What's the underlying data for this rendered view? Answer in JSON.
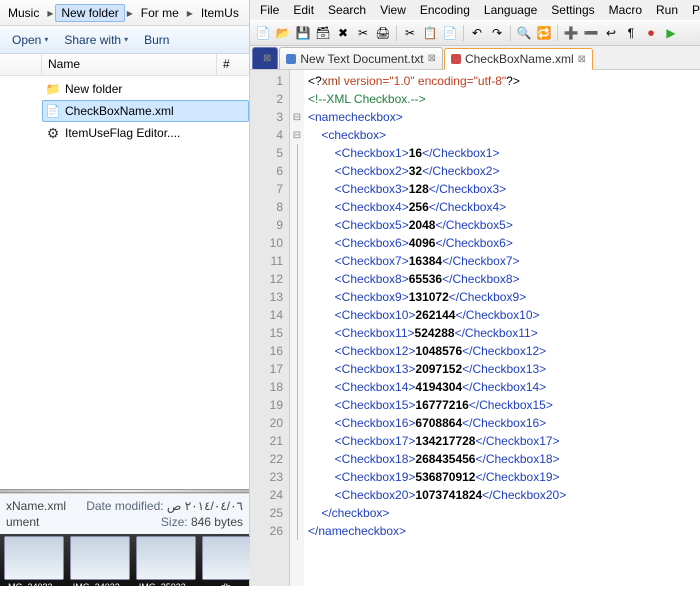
{
  "breadcrumb": {
    "items": [
      "Music",
      "New folder",
      "For me",
      "ItemUs"
    ]
  },
  "toolbar": {
    "open": "Open",
    "share": "Share with",
    "burn": "Burn"
  },
  "file_columns": {
    "name": "Name",
    "hash": "#"
  },
  "files": [
    {
      "name": "New folder",
      "icon": "folder"
    },
    {
      "name": "CheckBoxName.xml",
      "icon": "xml",
      "selected": true
    },
    {
      "name": "ItemUseFlag Editor....",
      "icon": "gear"
    }
  ],
  "status": {
    "file_label": "xName.xml",
    "modified_label": "Date modified:",
    "modified_value": "٢٠١٤/٠٤/٠٦ ص",
    "doc_label": "ument",
    "size_label": "Size:",
    "size_value": "846 bytes"
  },
  "thumbs": [
    "MG_24032...",
    "IMG_24032...",
    "IMG_25032...",
    "db_..."
  ],
  "menus": [
    "File",
    "Edit",
    "Search",
    "View",
    "Encoding",
    "Language",
    "Settings",
    "Macro",
    "Run",
    "Plug"
  ],
  "tabs": [
    {
      "label": "",
      "kind": "special"
    },
    {
      "label": "New Text Document.txt",
      "kind": "normal"
    },
    {
      "label": "CheckBoxName.xml",
      "kind": "active"
    }
  ],
  "xml": {
    "decl": {
      "pi_open": "<?",
      "name": "xml",
      "attrs": " version=\"1.0\" encoding=\"utf-8\"",
      "pi_close": "?>"
    },
    "comment": "<!--XML Checkbox.-->",
    "root_open": "<namecheckbox>",
    "group_open": "<checkbox>",
    "items": [
      {
        "n": 1,
        "v": "16"
      },
      {
        "n": 2,
        "v": "32"
      },
      {
        "n": 3,
        "v": "128"
      },
      {
        "n": 4,
        "v": "256"
      },
      {
        "n": 5,
        "v": "2048"
      },
      {
        "n": 6,
        "v": "4096"
      },
      {
        "n": 7,
        "v": "16384"
      },
      {
        "n": 8,
        "v": "65536"
      },
      {
        "n": 9,
        "v": "131072"
      },
      {
        "n": 10,
        "v": "262144"
      },
      {
        "n": 11,
        "v": "524288"
      },
      {
        "n": 12,
        "v": "1048576"
      },
      {
        "n": 13,
        "v": "2097152"
      },
      {
        "n": 14,
        "v": "4194304"
      },
      {
        "n": 15,
        "v": "16777216"
      },
      {
        "n": 16,
        "v": "6708864"
      },
      {
        "n": 17,
        "v": "134217728"
      },
      {
        "n": 18,
        "v": "268435456"
      },
      {
        "n": 19,
        "v": "536870912"
      },
      {
        "n": 20,
        "v": "1073741824"
      }
    ],
    "group_close": "</checkbox>",
    "root_close": "</namecheckbox>"
  }
}
